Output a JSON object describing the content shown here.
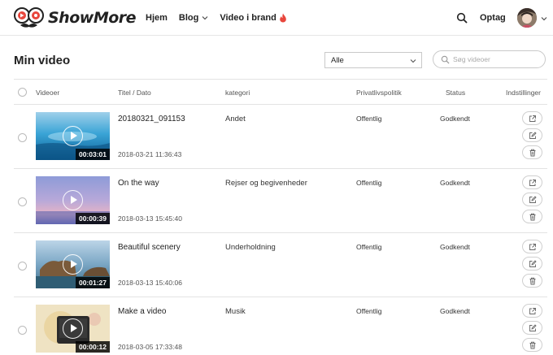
{
  "header": {
    "logo_text": "ShowMore",
    "nav": [
      {
        "label": "Hjem"
      },
      {
        "label": "Blog"
      },
      {
        "label": "Video i brand"
      }
    ],
    "record_label": "Optag"
  },
  "main": {
    "title": "Min video",
    "filter": {
      "selected": "Alle"
    },
    "search": {
      "placeholder": "Søg videoer",
      "value": ""
    }
  },
  "table": {
    "columns": {
      "videos": "Videoer",
      "title_date": "Titel / Dato",
      "category": "kategori",
      "privacy": "Privatlivspolitik",
      "status": "Status",
      "settings": "Indstillinger"
    },
    "rows": [
      {
        "title": "20180321_091153",
        "date": "2018-03-21 11:36:43",
        "duration": "00:03:01",
        "category": "Andet",
        "privacy": "Offentlig",
        "status": "Godkendt",
        "thumb": "ocean"
      },
      {
        "title": "On the way",
        "date": "2018-03-13 15:45:40",
        "duration": "00:00:39",
        "category": "Rejser og begivenheder",
        "privacy": "Offentlig",
        "status": "Godkendt",
        "thumb": "sky"
      },
      {
        "title": "Beautiful scenery",
        "date": "2018-03-13 15:40:06",
        "duration": "00:01:27",
        "category": "Underholdning",
        "privacy": "Offentlig",
        "status": "Godkendt",
        "thumb": "coast"
      },
      {
        "title": "Make a video",
        "date": "2018-03-05 17:33:48",
        "duration": "00:00:12",
        "category": "Musik",
        "privacy": "Offentlig",
        "status": "Godkendt",
        "thumb": "beige"
      }
    ]
  },
  "colors": {
    "accent": "#e8463c",
    "border": "#e3e3e3",
    "text": "#222222"
  },
  "icons": [
    "search-icon",
    "chevron-down-icon",
    "fire-icon",
    "share-icon",
    "edit-icon",
    "trash-icon",
    "play-icon"
  ]
}
